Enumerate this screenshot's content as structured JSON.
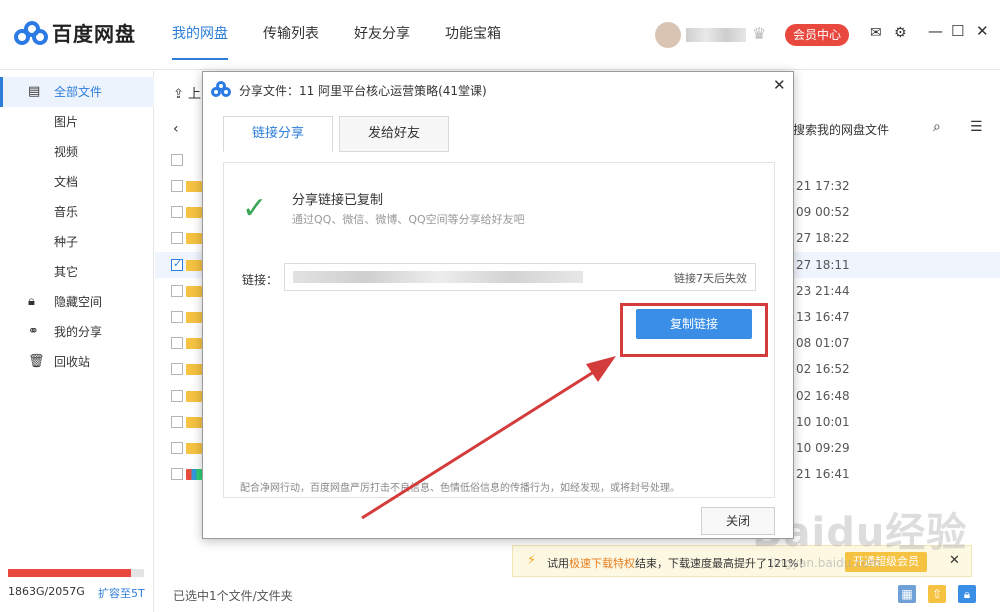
{
  "app": {
    "name": "百度网盘"
  },
  "nav": [
    {
      "label": "我的网盘",
      "active": true
    },
    {
      "label": "传输列表",
      "active": false
    },
    {
      "label": "好友分享",
      "active": false
    },
    {
      "label": "功能宝箱",
      "active": false
    }
  ],
  "header": {
    "vip_label": "会员中心"
  },
  "sidebar": {
    "items": [
      {
        "label": "全部文件",
        "icon": "file-icon",
        "active": true
      },
      {
        "label": "图片"
      },
      {
        "label": "视频"
      },
      {
        "label": "文档"
      },
      {
        "label": "音乐"
      },
      {
        "label": "种子"
      },
      {
        "label": "其它"
      },
      {
        "label": "隐藏空间",
        "icon": "lock-icon"
      },
      {
        "label": "我的分享",
        "icon": "share-icon"
      },
      {
        "label": "回收站",
        "icon": "trash-icon"
      }
    ],
    "storage": {
      "used_text": "1863G/2057G",
      "expand_label": "扩容至5T",
      "fraction": 0.906
    }
  },
  "main": {
    "upload_label": "上",
    "search_label": "搜索我的网盘文件",
    "rows": [
      {
        "time": "21 17:32",
        "checked": false
      },
      {
        "time": "09 00:52",
        "checked": false
      },
      {
        "time": "27 18:22",
        "checked": false
      },
      {
        "time": "27 18:11",
        "checked": true
      },
      {
        "time": "23 21:44",
        "checked": false
      },
      {
        "time": "13 16:47",
        "checked": false
      },
      {
        "time": "08 01:07",
        "checked": false
      },
      {
        "time": "02 16:52",
        "checked": false
      },
      {
        "time": "02 16:48",
        "checked": false
      },
      {
        "time": "10 10:01",
        "checked": false
      },
      {
        "time": "10 09:29",
        "checked": false
      },
      {
        "time": "21 16:41",
        "checked": false
      }
    ],
    "status_text": "已选中1个文件/文件夹"
  },
  "notice": {
    "prefix": "试用",
    "highlight": "极速下载特权",
    "suffix": "结束，下载速度最高提升了121%！",
    "button_label": "开通超级会员"
  },
  "dialog": {
    "title": "分享文件：11 阿里平台核心运营策略(41堂课)",
    "tabs": [
      {
        "label": "链接分享",
        "active": true
      },
      {
        "label": "发给好友",
        "active": false
      }
    ],
    "success_title": "分享链接已复制",
    "success_sub": "通过QQ、微信、微博、QQ空间等分享给好友吧",
    "link_label": "链接：",
    "link_expire": "链接7天后失效",
    "copy_label": "复制链接",
    "footer_note": "配合净网行动，百度网盘严厉打击不良信息、色情低俗信息的传播行为，如经发现，或将封号处理。",
    "close_label": "关闭"
  },
  "watermark": {
    "main": "Baidu经验",
    "sub": "jingyan.baidu.com"
  },
  "colors": {
    "accent": "#2e7dd9",
    "vip": "#e8483e",
    "annotation": "#d43b3b",
    "success": "#3aa757"
  }
}
